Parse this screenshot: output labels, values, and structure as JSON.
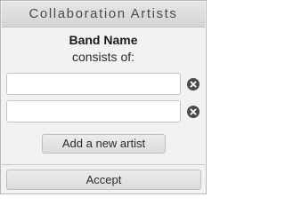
{
  "dialog": {
    "title": "Collaboration Artists",
    "band_name": "Band Name",
    "consists_of": "consists of:"
  },
  "artists": [
    {
      "value": "",
      "placeholder": "",
      "remove_icon": "close-circle-icon"
    },
    {
      "value": "",
      "placeholder": "",
      "remove_icon": "close-circle-icon"
    }
  ],
  "actions": {
    "add_label": "Add a new artist",
    "accept_label": "Accept"
  },
  "colors": {
    "panel_background": "#f2f2f2",
    "title_bar": "#dddddd",
    "remove_icon": "#4a4a4a"
  }
}
